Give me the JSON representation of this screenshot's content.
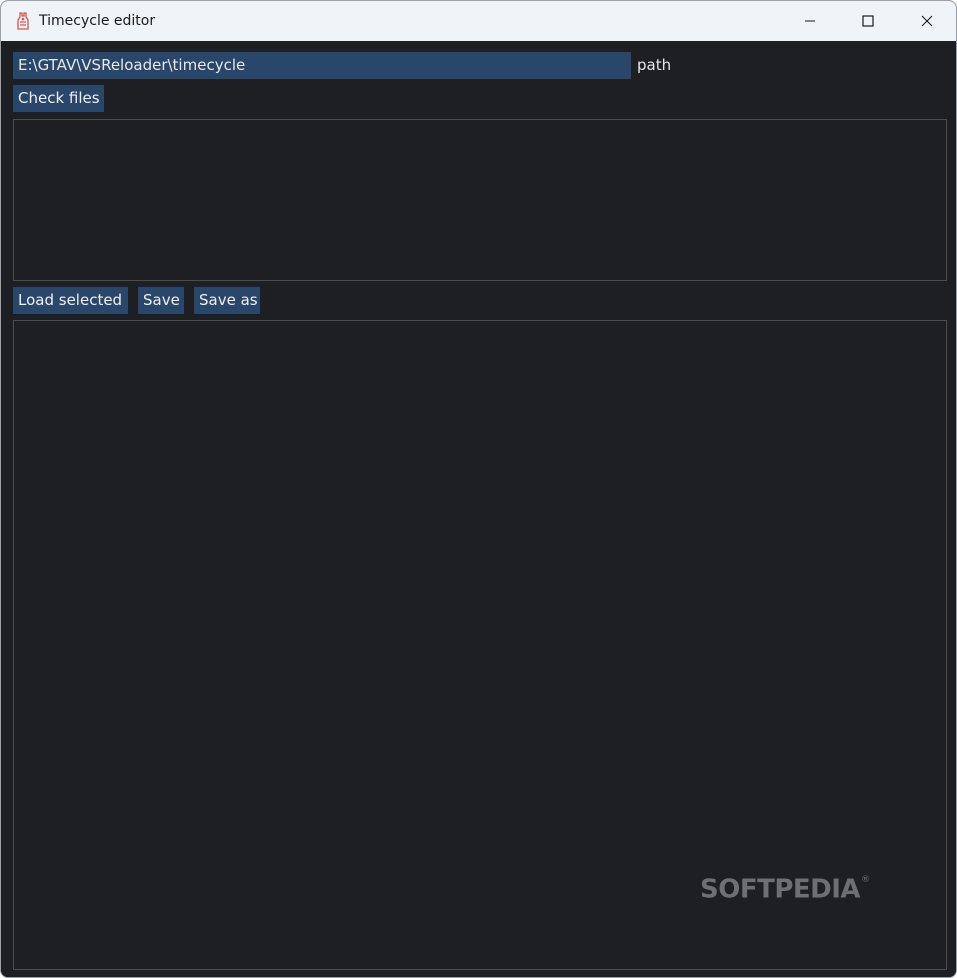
{
  "window": {
    "title": "Timecycle editor",
    "controls": {
      "minimize": "minimize-icon",
      "maximize": "maximize-icon",
      "close": "close-icon"
    }
  },
  "path": {
    "value": "E:\\GTAV\\VSReloader\\timecycle",
    "label": "path"
  },
  "buttons": {
    "check_files": "Check files",
    "load_selected": "Load selected",
    "save": "Save",
    "save_as": "Save as"
  },
  "watermark": {
    "text": "SOFTPEDIA",
    "mark": "®"
  },
  "colors": {
    "background": "#1e1f22",
    "widget": "#29466b",
    "titlebar": "#eff4f9",
    "border": "#4a4c50"
  }
}
